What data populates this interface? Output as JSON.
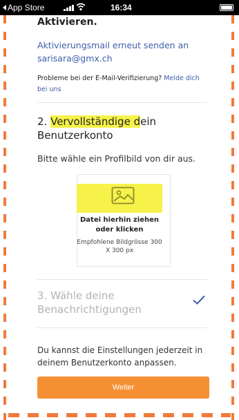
{
  "status_bar": {
    "back_label": "App Store",
    "time": "16:34",
    "icons": [
      "signal-icon",
      "wifi-icon",
      "battery-icon"
    ]
  },
  "verification": {
    "heading_partial": "Aktivieren.",
    "resend_link": "Aktivierungsmail erneut senden an sarisara@gmx.ch",
    "problem_text": "Probleme bei der E-Mail-Verifizierung?",
    "problem_link": "Melde dich bei uns"
  },
  "step2": {
    "title_prefix": "2. ",
    "title_highlight": "Vervollständige d",
    "title_rest": "ein Benutzerkonto",
    "subtitle": "Bitte wähle ein Profilbild von dir aus.",
    "upload": {
      "icon": "image-icon",
      "primary": "Datei hierhin ziehen oder klicken",
      "secondary": "Empfohlene Bildgrösse 300 X 300 px"
    }
  },
  "step3": {
    "title": "3. Wähle deine Benachrichtigungen",
    "icon": "checkmark-icon",
    "subtitle": "Du kannst die Einstellungen jederzeit in deinem Benutzerkonto anpassen."
  },
  "actions": {
    "continue_label": "Weiter"
  },
  "colors": {
    "accent": "#f58f33",
    "border_dashes": "#f07a3c",
    "link": "#3d5ca8",
    "highlight": "#f6f24a",
    "check": "#3d5ca8"
  }
}
